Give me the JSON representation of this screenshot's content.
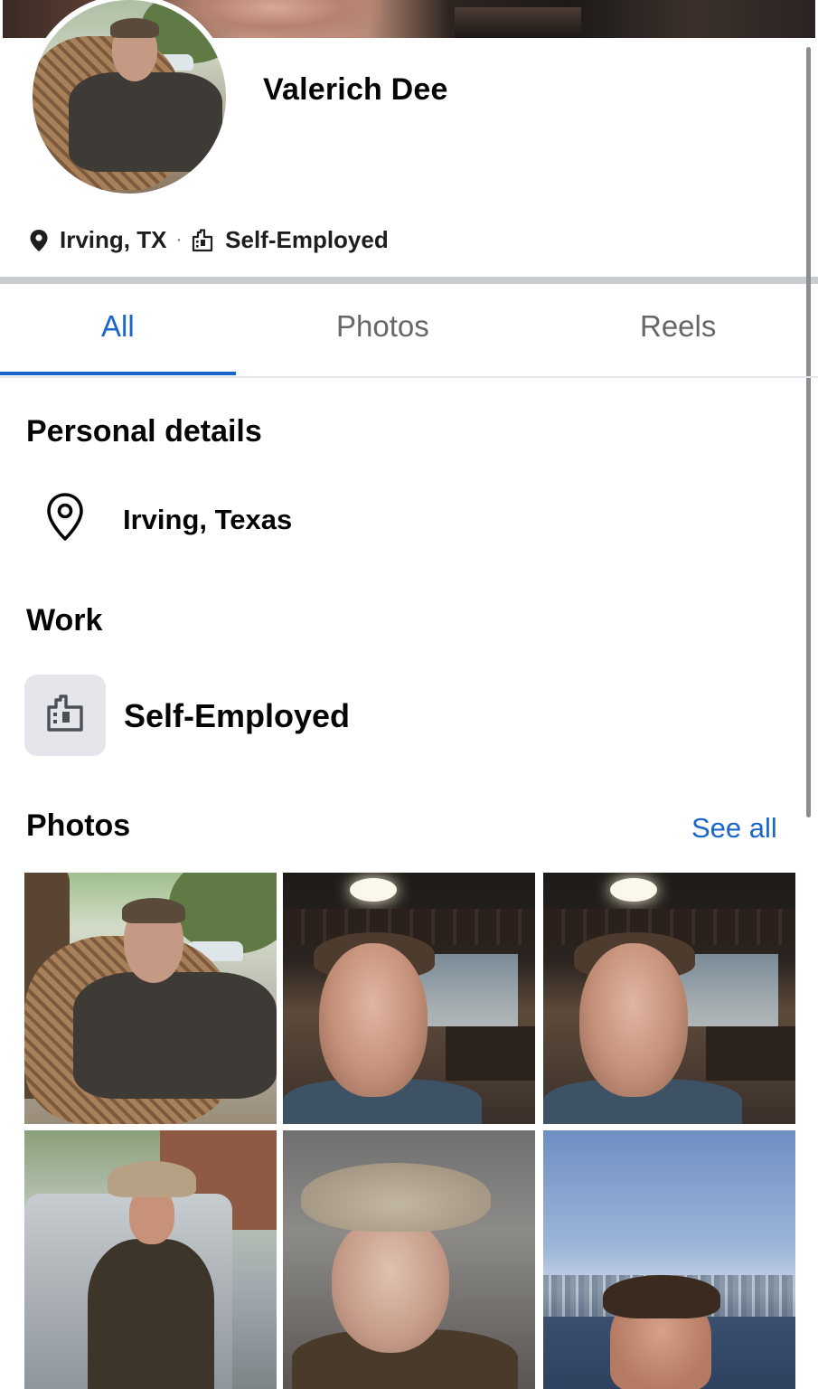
{
  "profile": {
    "name": "Valerich Dee",
    "location_short": "Irving, TX",
    "separator": "·",
    "work_short": "Self-Employed"
  },
  "tabs": [
    {
      "label": "All",
      "active": true
    },
    {
      "label": "Photos",
      "active": false
    },
    {
      "label": "Reels",
      "active": false
    }
  ],
  "personal_details": {
    "title": "Personal details",
    "location": "Irving, Texas"
  },
  "work": {
    "title": "Work",
    "employer": "Self-Employed"
  },
  "photos": {
    "title": "Photos",
    "see_all": "See all",
    "count_visible": 6
  },
  "colors": {
    "accent": "#1b66c9",
    "muted_text": "#65676b",
    "icon_bg": "#e4e6eb",
    "divider": "#c9ccd1"
  },
  "icons": {
    "meta_location": "map-pin-filled-icon",
    "meta_work": "building-icon",
    "detail_location": "map-pin-outline-icon",
    "detail_work": "building-icon"
  }
}
